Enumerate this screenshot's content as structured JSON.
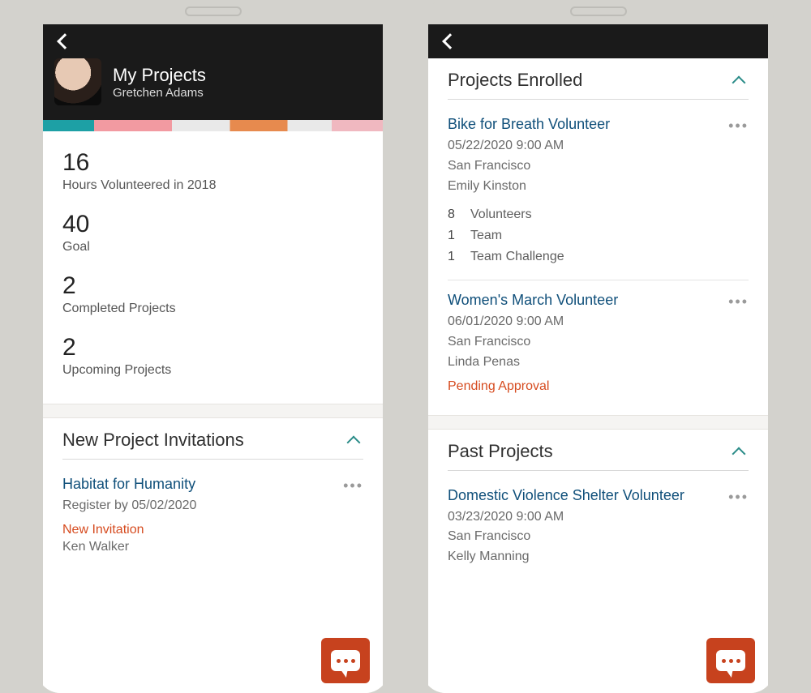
{
  "left": {
    "header": {
      "title": "My Projects",
      "subtitle": "Gretchen Adams"
    },
    "stats": [
      {
        "value": "16",
        "label": "Hours Volunteered in 2018"
      },
      {
        "value": "40",
        "label": "Goal"
      },
      {
        "value": "2",
        "label": "Completed Projects"
      },
      {
        "value": "2",
        "label": "Upcoming Projects"
      }
    ],
    "invitations": {
      "title": "New Project Invitations",
      "items": [
        {
          "title": "Habitat for Humanity",
          "register_by": "Register by 05/02/2020",
          "status": "New Invitation",
          "person": "Ken Walker"
        }
      ]
    }
  },
  "right": {
    "enrolled": {
      "title": "Projects Enrolled",
      "items": [
        {
          "title": "Bike for Breath Volunteer",
          "datetime": "05/22/2020 9:00 AM",
          "location": "San Francisco",
          "person": "Emily Kinston",
          "counts": [
            {
              "n": "8",
              "label": "Volunteers"
            },
            {
              "n": "1",
              "label": "Team"
            },
            {
              "n": "1",
              "label": "Team Challenge"
            }
          ]
        },
        {
          "title": "Women's March Volunteer",
          "datetime": "06/01/2020 9:00 AM",
          "location": "San Francisco",
          "person": "Linda Penas",
          "status": "Pending Approval"
        }
      ]
    },
    "past": {
      "title": "Past Projects",
      "items": [
        {
          "title": "Domestic Violence Shelter Volunteer",
          "datetime": "03/23/2020 9:00 AM",
          "location": "San Francisco",
          "person": "Kelly Manning"
        }
      ]
    }
  }
}
